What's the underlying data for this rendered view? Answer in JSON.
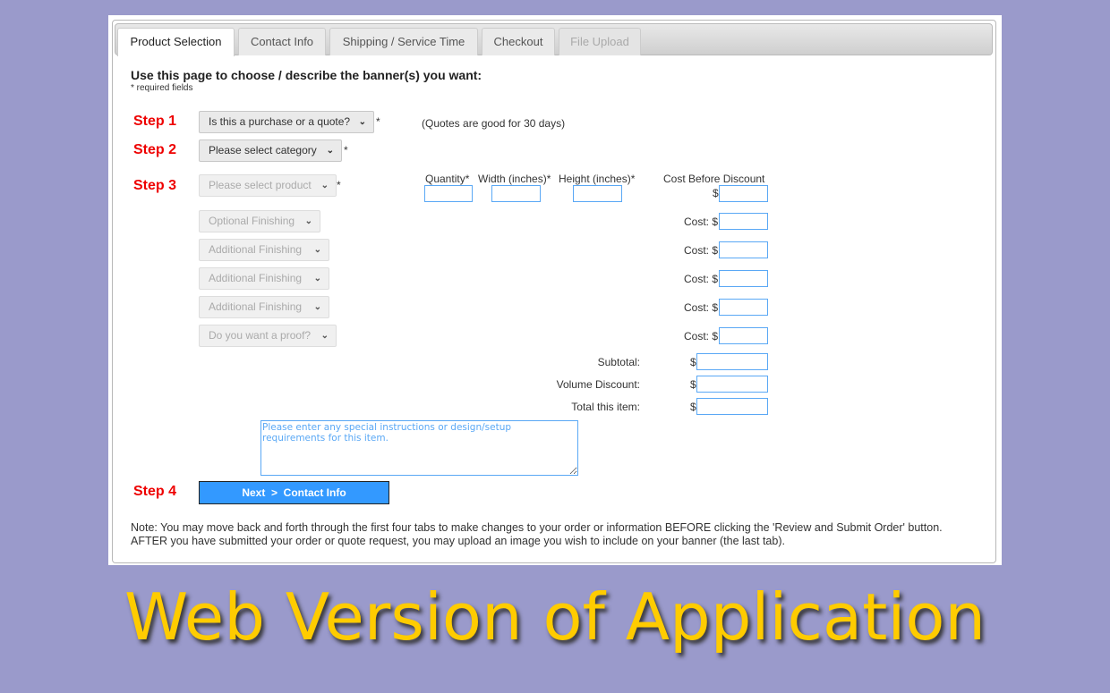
{
  "tabs": [
    {
      "label": "Product Selection",
      "state": "active"
    },
    {
      "label": "Contact Info",
      "state": "normal"
    },
    {
      "label": "Shipping / Service Time",
      "state": "normal"
    },
    {
      "label": "Checkout",
      "state": "normal"
    },
    {
      "label": "File Upload",
      "state": "disabled"
    }
  ],
  "heading": "Use this page to choose / describe the banner(s) you want:",
  "required_note": "* required fields",
  "steps": {
    "s1": "Step 1",
    "s2": "Step 2",
    "s3": "Step 3",
    "s4": "Step 4"
  },
  "selects": {
    "purchase_quote": "Is this a purchase or a quote?",
    "category": "Please select category",
    "product": "Please select product",
    "optional_finishing": "Optional Finishing",
    "additional_finishing_1": "Additional Finishing",
    "additional_finishing_2": "Additional Finishing",
    "additional_finishing_3": "Additional Finishing",
    "proof": "Do you want a proof?"
  },
  "asterisk": "*",
  "quote_note": "(Quotes are good for 30 days)",
  "columns": {
    "quantity": "Quantity*",
    "width": "Width (inches)*",
    "height": "Height (inches)*",
    "cost_before_discount": "Cost Before Discount"
  },
  "dollar": "$",
  "cost_label": "Cost: $",
  "totals": {
    "subtotal": "Subtotal:",
    "volume_discount": "Volume Discount:",
    "total": "Total this item:"
  },
  "instructions_placeholder": "Please enter any special instructions or design/setup requirements for this item.",
  "next_button": "Next  >  Contact Info",
  "note": "Note: You may move back and forth through the first four tabs to make changes to your order or information BEFORE clicking the 'Review and Submit Order' button. AFTER you have submitted your order or quote request, you may upload an image you wish to include on your banner (the last tab).",
  "caption": "Web Version of Application",
  "colors": {
    "background": "#9a9acb",
    "step": "#ee0000",
    "button": "#3399ff",
    "caption": "#ffcc00",
    "input_border": "#5aa8f5"
  }
}
